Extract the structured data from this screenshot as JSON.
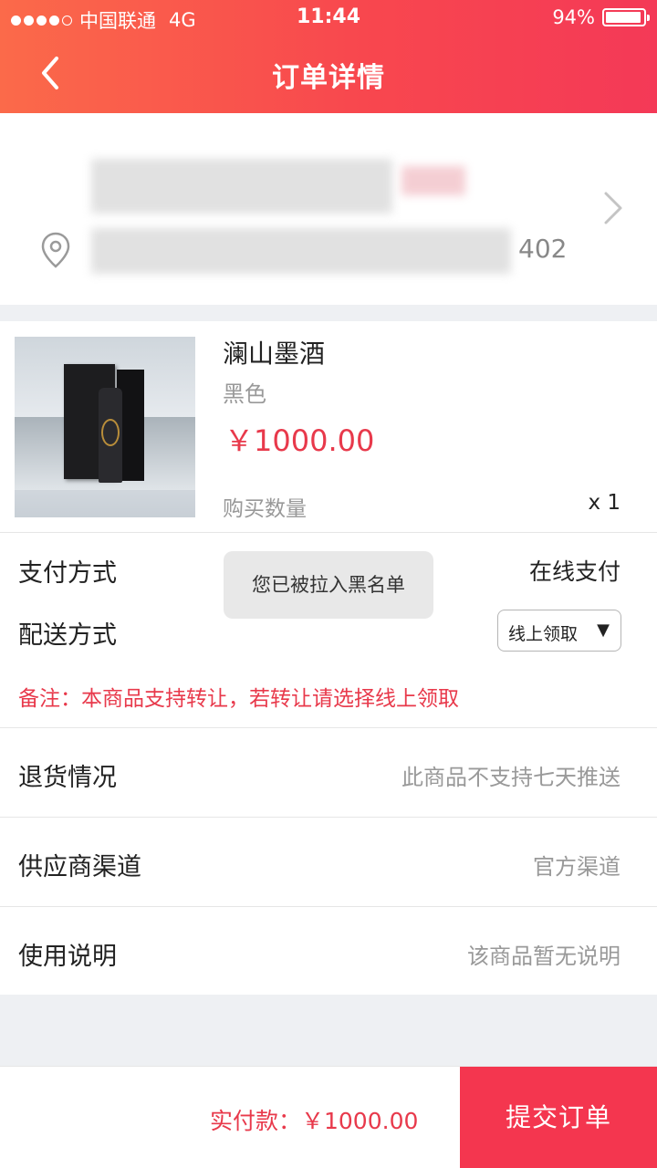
{
  "status_bar": {
    "carrier": "中国联通",
    "network": "4G",
    "time": "11:44",
    "battery": "94%",
    "battery_level": 0.94
  },
  "header": {
    "title": "订单详情",
    "back_icon": "chevron-left-icon"
  },
  "address": {
    "line_visible": "402",
    "location_icon": "map-pin-icon",
    "chevron_icon": "chevron-right-icon"
  },
  "product": {
    "name": "澜山墨酒",
    "color": "黑色",
    "price": "￥1000.00",
    "quantity_label": "购买数量",
    "quantity": "x 1"
  },
  "payment": {
    "method_label": "支付方式",
    "method_value": "在线支付",
    "delivery_label": "配送方式",
    "delivery_value": "线上领取",
    "note": "备注：本商品支持转让，若转让请选择线上领取",
    "toast": "您已被拉入黑名单"
  },
  "info_rows": [
    {
      "label": "退货情况",
      "value": "此商品不支持七天推送"
    },
    {
      "label": "供应商渠道",
      "value": "官方渠道"
    },
    {
      "label": "使用说明",
      "value": "该商品暂无说明"
    }
  ],
  "footer": {
    "total": "实付款：￥1000.00",
    "submit": "提交订单"
  },
  "colors": {
    "accent": "#f4364f",
    "price": "#e8394b",
    "header_start": "#fb6a4a",
    "header_end": "#f43957"
  }
}
